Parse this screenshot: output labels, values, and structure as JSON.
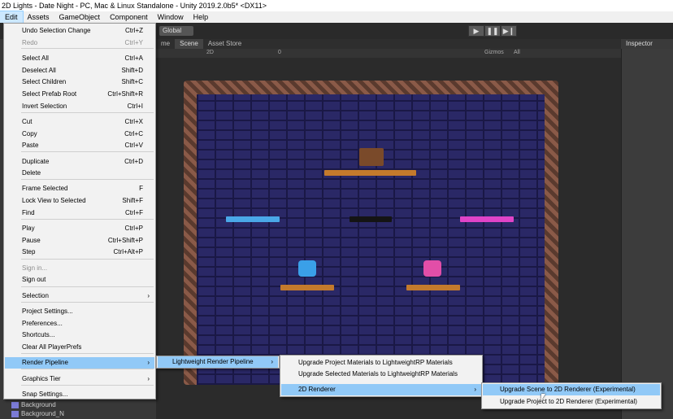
{
  "window_title": "2D Lights - Date Night - PC, Mac & Linux Standalone - Unity 2019.2.0b5* <DX11>",
  "menubar": [
    "Edit",
    "Assets",
    "GameObject",
    "Component",
    "Window",
    "Help"
  ],
  "toolbar": {
    "global": "Global",
    "play": "▶",
    "pause": "❚❚",
    "step": "▶❙"
  },
  "tabs": {
    "game": "me",
    "scene": "Scene",
    "asset_store": "Asset Store",
    "inspector": "Inspector"
  },
  "scenebar": {
    "mode": "2D",
    "gizmos": "Gizmos",
    "search": "All",
    "count": "0"
  },
  "hierarchy": [
    "Background",
    "Background_N"
  ],
  "edit_menu": [
    {
      "label": "Undo Selection Change",
      "shortcut": "Ctrl+Z"
    },
    {
      "label": "Redo",
      "shortcut": "Ctrl+Y",
      "disabled": true
    },
    {
      "label": "Select All",
      "shortcut": "Ctrl+A"
    },
    {
      "label": "Deselect All",
      "shortcut": "Shift+D"
    },
    {
      "label": "Select Children",
      "shortcut": "Shift+C"
    },
    {
      "label": "Select Prefab Root",
      "shortcut": "Ctrl+Shift+R"
    },
    {
      "label": "Invert Selection",
      "shortcut": "Ctrl+I"
    },
    {
      "label": "Cut",
      "shortcut": "Ctrl+X"
    },
    {
      "label": "Copy",
      "shortcut": "Ctrl+C"
    },
    {
      "label": "Paste",
      "shortcut": "Ctrl+V"
    },
    {
      "label": "Duplicate",
      "shortcut": "Ctrl+D"
    },
    {
      "label": "Delete",
      "shortcut": ""
    },
    {
      "label": "Frame Selected",
      "shortcut": "F"
    },
    {
      "label": "Lock View to Selected",
      "shortcut": "Shift+F"
    },
    {
      "label": "Find",
      "shortcut": "Ctrl+F"
    },
    {
      "label": "Play",
      "shortcut": "Ctrl+P"
    },
    {
      "label": "Pause",
      "shortcut": "Ctrl+Shift+P"
    },
    {
      "label": "Step",
      "shortcut": "Ctrl+Alt+P"
    },
    {
      "label": "Sign in...",
      "shortcut": "",
      "disabled": true
    },
    {
      "label": "Sign out",
      "shortcut": ""
    },
    {
      "label": "Selection",
      "shortcut": ""
    },
    {
      "label": "Project Settings...",
      "shortcut": ""
    },
    {
      "label": "Preferences...",
      "shortcut": ""
    },
    {
      "label": "Shortcuts...",
      "shortcut": ""
    },
    {
      "label": "Clear All PlayerPrefs",
      "shortcut": ""
    },
    {
      "label": "Render Pipeline",
      "shortcut": ""
    },
    {
      "label": "Graphics Tier",
      "shortcut": ""
    },
    {
      "label": "Snap Settings...",
      "shortcut": ""
    }
  ],
  "submenu_render_pipeline": [
    "Lightweight Render Pipeline"
  ],
  "submenu_lwrp": [
    "Upgrade Project Materials to LightweightRP Materials",
    "Upgrade Selected Materials to LightweightRP Materials",
    "2D Renderer"
  ],
  "submenu_2d_renderer": [
    "Upgrade Scene to 2D Renderer (Experimental)",
    "Upgrade Project to 2D Renderer (Experimental)"
  ],
  "colors": {
    "menu_highlight": "#91c9f7",
    "wall": "#2a2866",
    "platform_wood": "#c47a2c",
    "platform_blue": "#4aa8e8",
    "platform_pink": "#e044c8",
    "char_blue": "#3aa0e8",
    "char_pink": "#e24ea8"
  }
}
